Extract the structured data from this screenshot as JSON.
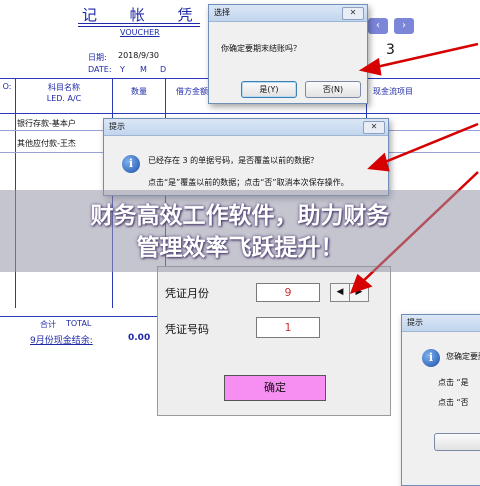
{
  "voucher": {
    "title": "记 帐 凭 证",
    "subtitle": "VOUCHER",
    "date_label": "日期:",
    "date_value": "2018/9/30",
    "date_en_label": "DATE:",
    "date_parts": [
      "Y",
      "M",
      "D"
    ],
    "voucher_no": "3",
    "nav_prev": "‹",
    "nav_next": "›",
    "headers": {
      "summary_partial": "O:",
      "subject": "科目名称",
      "subject_en": "LED. A/C",
      "quantity": "数量",
      "debit": "借方金额",
      "cashflow": "现金流项目"
    },
    "rows": [
      {
        "subject": "银行存款-基本户"
      },
      {
        "subject": "其他应付款-王杰"
      }
    ],
    "total_label": "合计",
    "total_en": "TOTAL",
    "balance_label": "9月份现金结余:",
    "balance_value": "0.00"
  },
  "dialog_close_month": {
    "title": "选择",
    "message": "你确定要期末结账吗？",
    "yes_label": "是(Y)",
    "no_label": "否(N)"
  },
  "dialog_overwrite": {
    "title": "提示",
    "message": "已经存在 3 的单据号码，是否覆盖以前的数据？",
    "hint": "点击“是”覆盖以前的数据；点击“否”取消本次保存操作。"
  },
  "voucher_form": {
    "month_label": "凭证月份",
    "month_value": "9",
    "number_label": "凭证号码",
    "number_value": "1",
    "confirm_label": "确定"
  },
  "dialog_partial": {
    "title": "提示",
    "message_partial": "您确定要删",
    "hint_yes": "点击 “是",
    "hint_no": "点击 “否"
  },
  "banner": {
    "line1": "财务高效工作软件，助力财务",
    "line2": "管理效率飞跃提升！"
  },
  "colors": {
    "voucher_ink": "#1f2aa8",
    "arrow": "#d60000",
    "confirm_button": "#f78ef1"
  }
}
